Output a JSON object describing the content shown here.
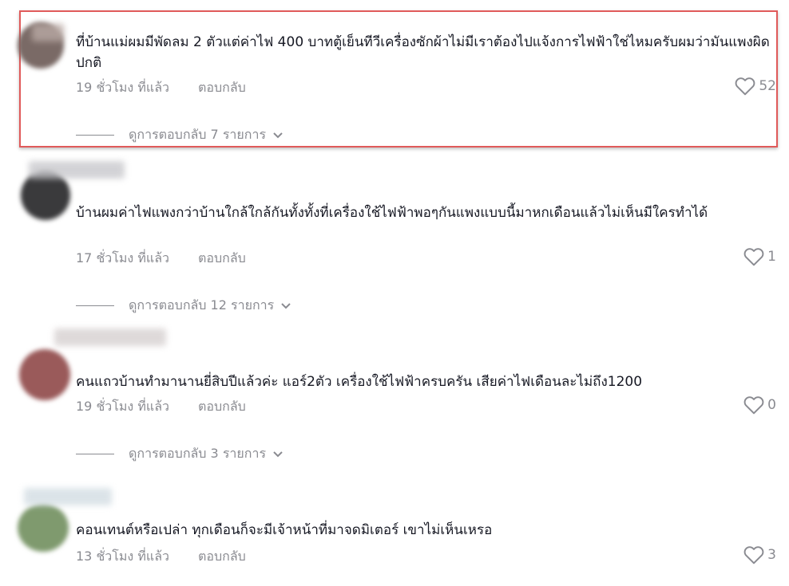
{
  "comments": [
    {
      "text": "ที่บ้านแม่ผมมีพัดลม 2 ตัวแต่ค่าไฟ 400 บาทตู้เย็นทีวีเครื่องซักผ้าไม่มีเราต้องไปแจ้งการไฟฟ้าใช่ไหมครับผมว่ามันแพงผิดปกติ",
      "time": "19 ชั่วโมง ที่แล้ว",
      "reply_label": "ตอบกลับ",
      "likes": "52",
      "view_replies": "ดูการตอบกลับ 7 รายการ",
      "avatar_color": "#7a6a66"
    },
    {
      "text": "บ้านผมค่าไฟแพงกว่าบ้านใกล้ใกล้กันทั้งทั้งที่เครื่องใช้ไฟฟ้าพอๆกันแพงแบบนี้มาหกเดือนแล้วไม่เห็นมีใครทำได้",
      "time": "17 ชั่วโมง ที่แล้ว",
      "reply_label": "ตอบกลับ",
      "likes": "1",
      "view_replies": "ดูการตอบกลับ 12 รายการ",
      "avatar_color": "#3a3a3c"
    },
    {
      "text": "คนแถวบ้านทำมานานยี่สิบปีแล้วค่ะ แอร์2ตัว เครื่องใช้ไฟฟ้าครบครัน เสียค่าไฟเดือนละไม่ถึง1200",
      "time": "19 ชั่วโมง ที่แล้ว",
      "reply_label": "ตอบกลับ",
      "likes": "0",
      "view_replies": "ดูการตอบกลับ 3 รายการ",
      "avatar_color": "#9a5a5a"
    },
    {
      "text": "คอนเทนต์หรือเปล่า ทุกเดือนก็จะมีเจ้าหน้าที่มาจดมิเตอร์ เขาไม่เห็นเหรอ",
      "time": "13 ชั่วโมง ที่แล้ว",
      "reply_label": "ตอบกลับ",
      "likes": "3",
      "avatar_color": "#7f9a6e"
    }
  ],
  "highlight_color": "#e05a5a"
}
